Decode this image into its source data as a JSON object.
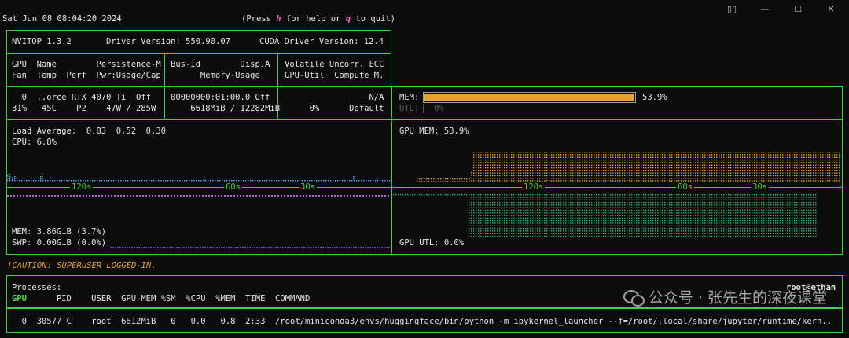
{
  "header": {
    "datetime": "Sat Jun 08 08:04:20 2024",
    "help_prefix": "(Press ",
    "help_key": "h",
    "help_mid": " for help or ",
    "quit_key": "q",
    "help_suffix": " to quit)"
  },
  "window_controls": {
    "sidebar": "▯▯",
    "minimize": "—",
    "maximize": "☐",
    "close": "✕"
  },
  "info": {
    "version": "NVITOP 1.3.2",
    "driver": "Driver Version: 550.90.07",
    "cuda": "CUDA Driver Version: 12.4"
  },
  "gpu_table": {
    "col1_h1": "GPU  Name        Persistence-M",
    "col1_h2": "Fan  Temp  Perf  Pwr:Usage/Cap",
    "col2_h1": "Bus-Id        Disp.A",
    "col2_h2": "      Memory-Usage",
    "col3_h1": "Volatile Uncorr. ECC",
    "col3_h2": "GPU-Util  Compute M.",
    "row1_col1": "  0  ..orce RTX 4070 Ti  Off",
    "row2_col1": "31%   45C    P2    47W / 285W",
    "row1_col2": "00000000:01:00.0 Off",
    "row2_col2": "    6618MiB / 12282MiB",
    "row1_col3": "                 N/A",
    "row2_col3": "     0%      Default"
  },
  "mem_bars": {
    "mem_label": "MEM:",
    "mem_percent": "53.9%",
    "mem_fraction": 0.539,
    "utl_label": "UTL:",
    "utl_percent": "0%"
  },
  "cpu_panel": {
    "load_average": "Load Average:  0.83  0.52  0.30",
    "cpu": "CPU: 6.8%",
    "mem": "MEM: 3.86GiB (3.7%)",
    "swp": "SWP: 0.00GiB (0.0%)",
    "tick_120": "120s",
    "tick_60": "60s",
    "tick_30": "30s"
  },
  "gpu_panel": {
    "gpu_mem": "GPU MEM: 53.9%",
    "gpu_utl": "GPU UTL: 0.0%",
    "tick_120": "120s",
    "tick_60": "60s",
    "tick_30": "30s"
  },
  "caution": "!CAUTION: SUPERUSER LOGGED-IN.",
  "processes": {
    "title": "Processes:",
    "user_host": "root@ethan",
    "headers": "GPU      PID    USER  GPU-MEM %SM  %CPU  %MEM  TIME  COMMAND",
    "row": "  0  30577 C    root  6612MiB   0   0.0   0.8  2:33  /root/miniconda3/envs/huggingface/bin/python -m ipykernel_launcher --f=/root/.local/share/jupyter/runtime/kern.."
  },
  "watermark": "公众号 · 张先生的深夜课堂",
  "colors": {
    "border": "#3fd13f",
    "mem_bar": "#e6a32e",
    "cpu_graph": "#5aa7ff",
    "mem_graph": "#c05ee8",
    "gpu_mem_graph": "#e6a32e",
    "gpu_utl_graph": "#37b36a",
    "caution": "#e09e3b"
  }
}
